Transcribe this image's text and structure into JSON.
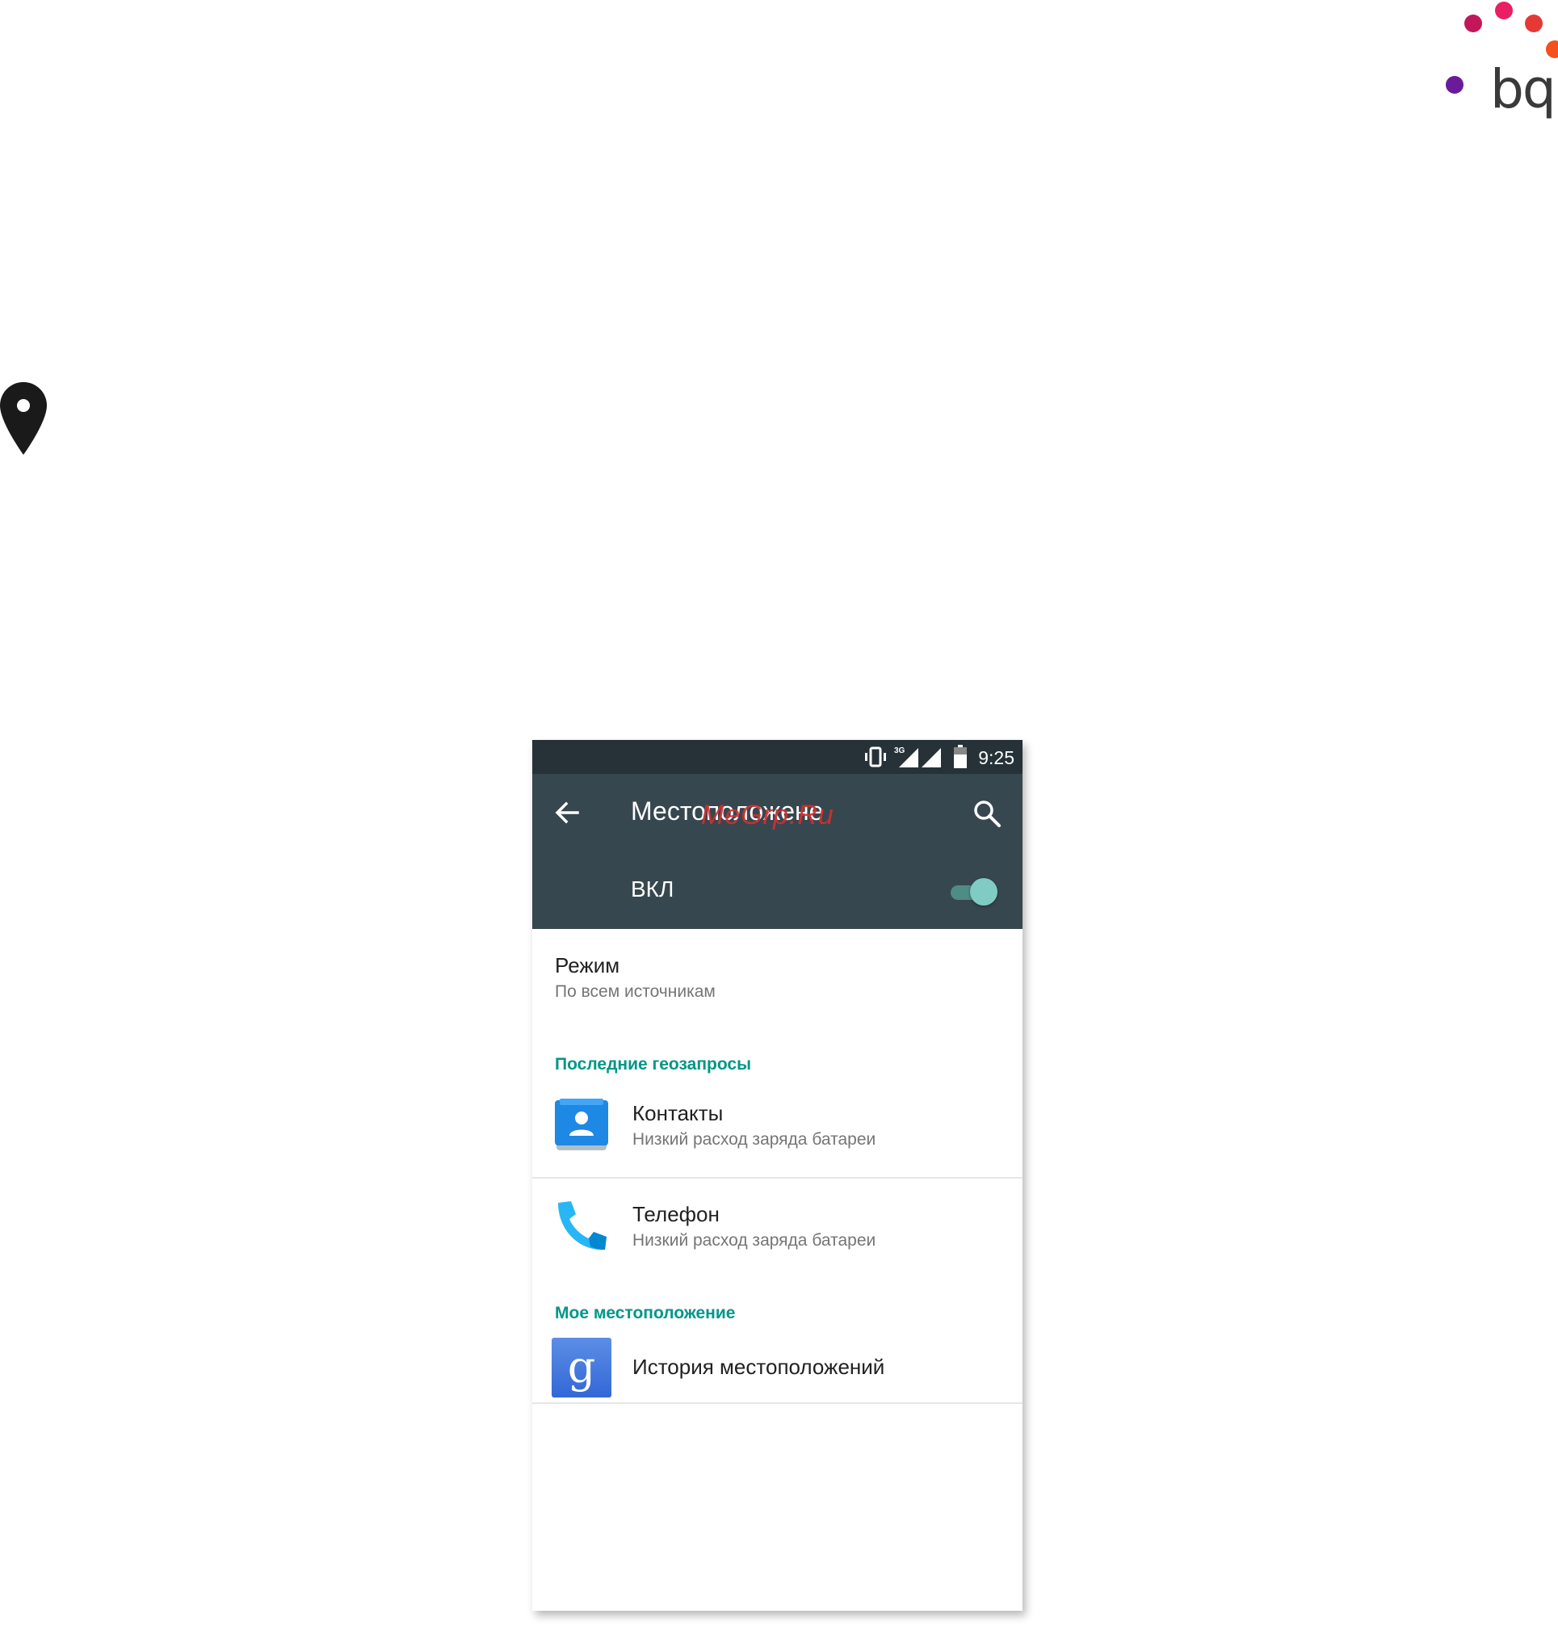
{
  "brand": {
    "logo_text": "bq",
    "dot_colors": [
      "#c2185b",
      "#e91e63",
      "#e53935",
      "#f4511e",
      "#6a1b9a"
    ]
  },
  "page_icon": "location-pin-icon",
  "phone": {
    "status_bar": {
      "time": "9:25",
      "network_label": "3G",
      "icons": [
        "vibrate-icon",
        "signal-3g-icon",
        "signal-icon",
        "battery-icon"
      ]
    },
    "app_bar": {
      "title": "Местоположене",
      "watermark": "MeGrp.Ru",
      "back_icon": "arrow-back-icon",
      "search_icon": "search-icon"
    },
    "master_switch": {
      "label": "ВКЛ",
      "state": "on"
    },
    "mode": {
      "title": "Режим",
      "summary": "По всем источникам"
    },
    "recent_requests": {
      "header": "Последние геозапросы",
      "items": [
        {
          "title": "Контакты",
          "summary": "Низкий расход заряда батареи",
          "icon": "contacts-app-icon"
        },
        {
          "title": "Телефон",
          "summary": "Низкий расход заряда батареи",
          "icon": "phone-app-icon"
        }
      ]
    },
    "my_location": {
      "header": "Мое местоположение",
      "items": [
        {
          "title": "История местоположений",
          "icon": "google-app-icon"
        }
      ]
    },
    "colors": {
      "status_bar": "#263238",
      "app_bar": "#37474f",
      "accent": "#009688",
      "toggle_thumb": "#80cbc4"
    }
  }
}
